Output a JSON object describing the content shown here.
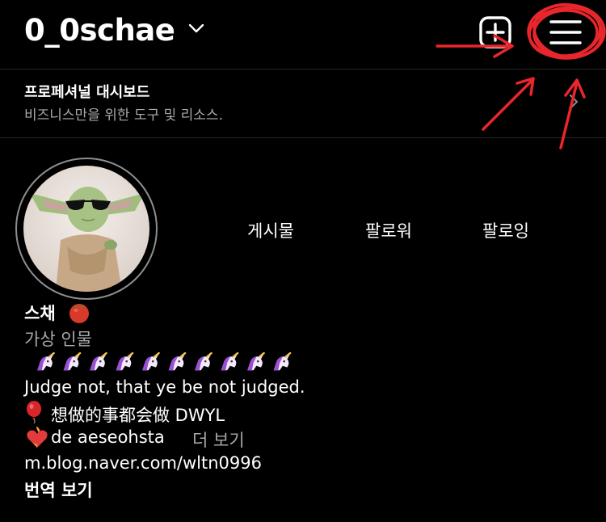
{
  "header": {
    "username": "0_0schae",
    "chevron_icon": "chevron-down-icon",
    "new_post_icon": "plus-square-icon",
    "menu_icon": "hamburger-menu-icon"
  },
  "dashboard": {
    "title": "프로페셔널 대시보드",
    "subtitle": "비즈니스만을 위한 도구 및 리소스.",
    "arrow_icon": "chevron-right-icon"
  },
  "stats": {
    "posts_label": "게시물",
    "followers_label": "팔로워",
    "following_label": "팔로잉"
  },
  "bio": {
    "name": "스채",
    "category": "가상 인물",
    "line1": "Judge not, that ye be not judged.",
    "line2": "想做的事都会做 DWYL",
    "line3": "de aeseohsta",
    "more": "더 보기",
    "link": "m.blog.naver.com/wltn0996",
    "translate": "번역 보기"
  },
  "colors": {
    "background": "#000000",
    "text": "#ffffff",
    "secondary_text": "#a8a8a8",
    "annotation_red": "#e8262c",
    "unicorn_purple": "#9b4fd6"
  }
}
